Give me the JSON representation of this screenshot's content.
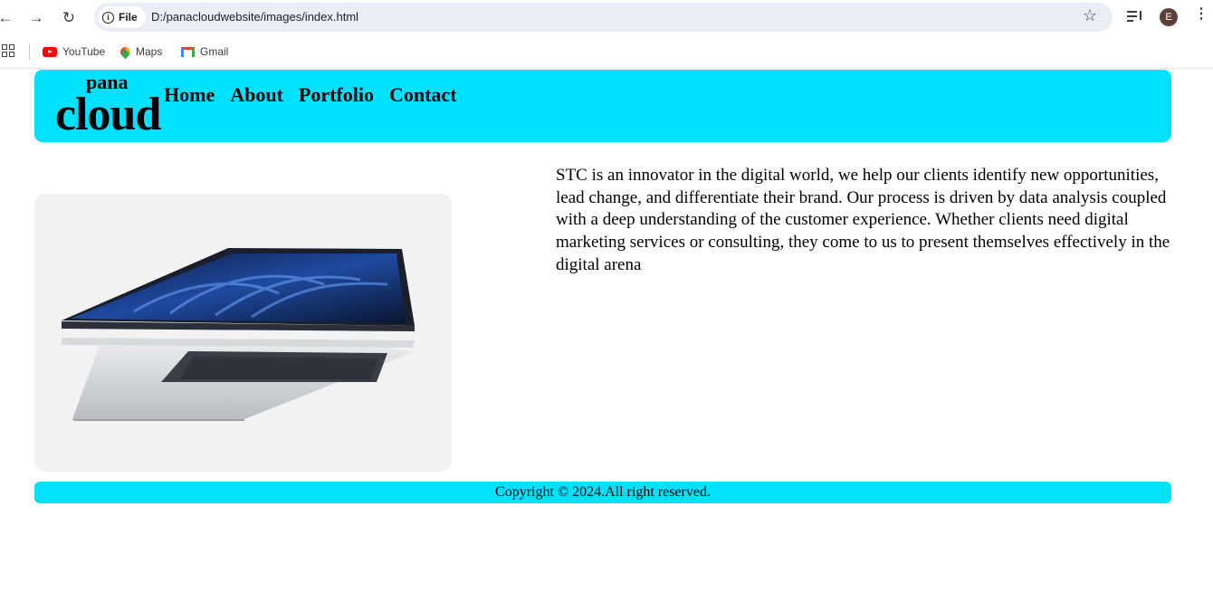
{
  "browser": {
    "site_chip": "File",
    "address": "D:/panacloudwebsite/images/index.html",
    "profile_initial": "E",
    "icons": {
      "back": "arrow-left-icon",
      "forward": "arrow-right-icon",
      "reload": "reload-icon",
      "info": "info-icon",
      "bookmark": "star-icon",
      "media": "media-playlist-icon",
      "menu": "kebab-menu-icon",
      "apps": "apps-grid-icon"
    }
  },
  "bookmarks": [
    {
      "label": "YouTube",
      "icon": "youtube-icon"
    },
    {
      "label": "Maps",
      "icon": "maps-icon"
    },
    {
      "label": "Gmail",
      "icon": "gmail-icon"
    }
  ],
  "page": {
    "logo": {
      "top": "pana",
      "main": "cloud"
    },
    "nav": [
      "Home",
      "About",
      "Portfolio",
      "Contact"
    ],
    "hero_image": "laptop-image",
    "description": "STC is an innovator in the digital world, we help our clients identify new opportunities, lead change, and differentiate their brand. Our process is driven by data analysis coupled with a deep understanding of the customer experience. Whether clients need digital marketing services or consulting, they come to us to present themselves effectively in the digital arena",
    "footer": "Copyright © 2024.All right reserved."
  },
  "colors": {
    "accent": "#00e1ff",
    "omnibox": "#e9eef6",
    "avatar": "#5d4037",
    "image_bg": "#f2f2f3"
  }
}
